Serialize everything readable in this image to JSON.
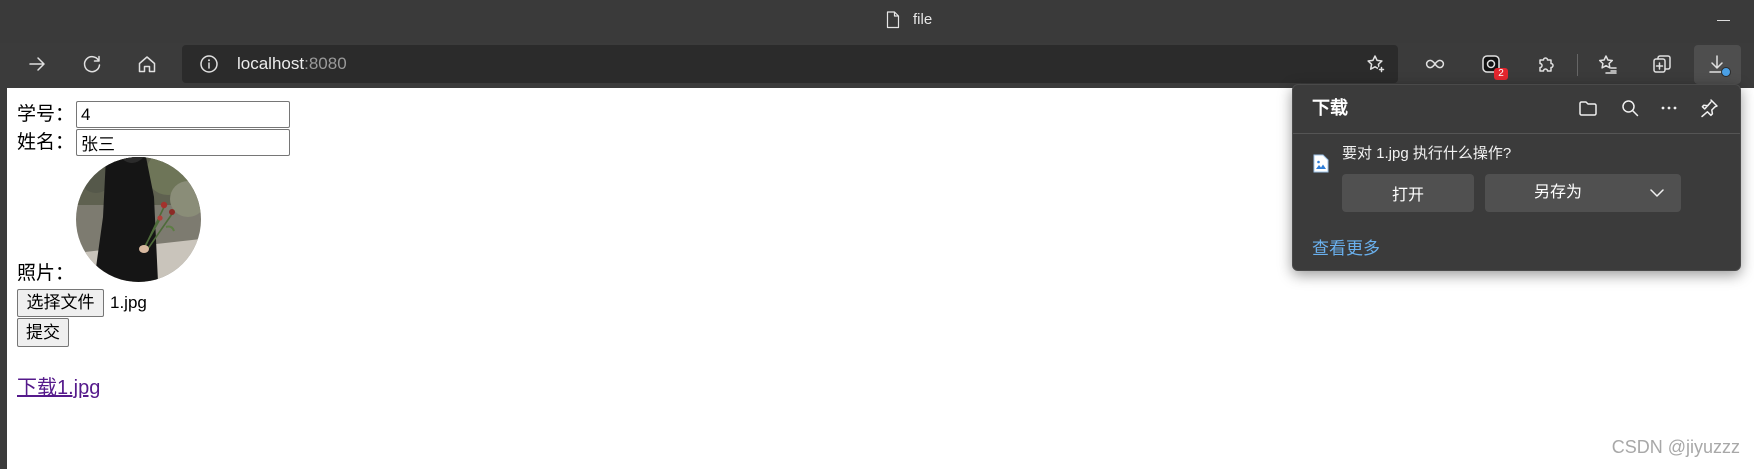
{
  "window": {
    "title": "file"
  },
  "toolbar": {
    "address": {
      "host": "localhost",
      "port": ":8080"
    },
    "extension_badge": "2"
  },
  "form": {
    "student_id": {
      "label": "学号：",
      "value": "4"
    },
    "name": {
      "label": "姓名：",
      "value": "张三"
    },
    "photo": {
      "label": "照片："
    },
    "choose_file_label": "选择文件",
    "chosen_file": "1.jpg",
    "submit_label": "提交",
    "download_link": "下载1.jpg"
  },
  "downloads_panel": {
    "title": "下载",
    "prompt": "要对 1.jpg 执行什么操作?",
    "open_label": "打开",
    "save_as_label": "另存为",
    "see_more_label": "查看更多"
  },
  "watermark": "CSDN @jiyuzzz",
  "icons": {
    "title": "file-icon",
    "toolbar": [
      "forward-icon",
      "refresh-icon",
      "home-icon",
      "info-icon",
      "star-plus-icon",
      "infinity-icon",
      "extension-icon",
      "puzzle-icon",
      "favorites-icon",
      "collections-icon",
      "download-icon"
    ],
    "panel": [
      "folder-icon",
      "search-icon",
      "more-icon",
      "pin-icon",
      "image-file-icon",
      "chevron-down-icon"
    ]
  },
  "colors": {
    "browser_chrome": "#3b3b3b",
    "address_bar": "#2b2b2b",
    "visited_link": "#551a8b",
    "panel_link": "#6ab0ed",
    "badge_red": "#e3262e",
    "download_badge": "#4aa0e6"
  }
}
